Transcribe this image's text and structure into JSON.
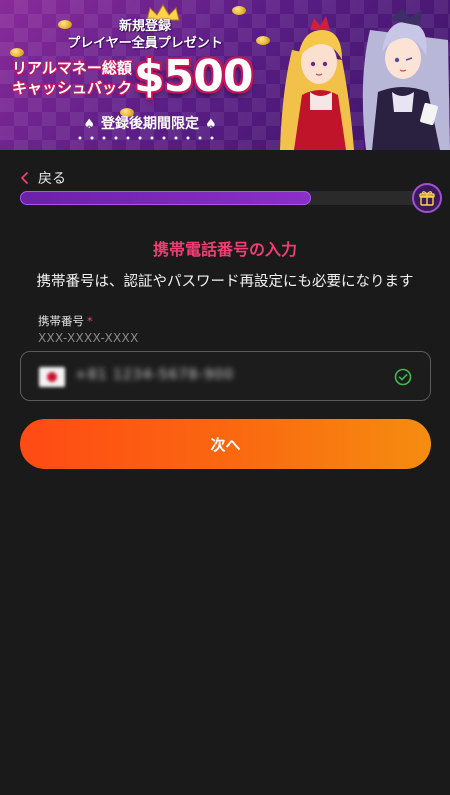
{
  "banner": {
    "headline_line1": "新規登録",
    "headline_line2": "プレイヤー全員プレゼント",
    "money_line1": "リアルマネー総額",
    "money_line2": "キャッシュバック",
    "amount": "$500",
    "limited": "登録後期間限定"
  },
  "nav": {
    "back_label": "戻る"
  },
  "progress": {
    "fraction": 0.71
  },
  "form": {
    "title": "携帯電話番号の入力",
    "subtitle": "携帯番号は、認証やパスワード再設定にも必要になります",
    "phone_label": "携帯番号",
    "required_mark": "*",
    "phone_hint": "XXX-XXXX-XXXX",
    "phone_value": "+81 1234-5678-900",
    "next_label": "次へ"
  },
  "colors": {
    "accent_pink": "#ef3e73",
    "progress_purple": "#8b2fc9",
    "button_orange_start": "#ff4a14",
    "button_orange_end": "#f58d10",
    "valid_green": "#3fb950"
  },
  "icons": {
    "back": "chevron-left-icon",
    "reward": "gift-icon",
    "valid": "check-circle-icon",
    "country": "japan-flag-icon"
  }
}
